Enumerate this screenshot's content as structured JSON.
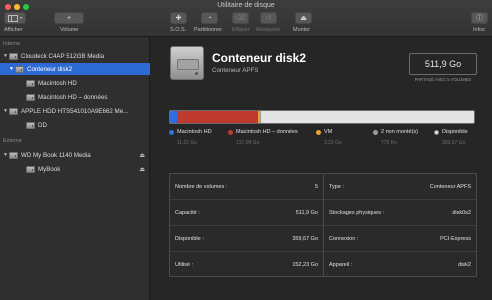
{
  "window": {
    "title": "Utilitaire de disque"
  },
  "toolbar": {
    "items": [
      {
        "label": "Afficher",
        "icon": "sidebar-toggle-icon",
        "enabled": true
      },
      {
        "label": "Volume",
        "icon": "plus-icon",
        "glyph": "+",
        "enabled": true
      },
      {
        "label": "S.O.S.",
        "icon": "stethoscope-icon",
        "glyph": "✚",
        "enabled": true
      },
      {
        "label": "Partitionner",
        "icon": "partition-icon",
        "glyph": "◔",
        "enabled": true
      },
      {
        "label": "Effacer",
        "icon": "erase-icon",
        "glyph": "⌫",
        "enabled": false
      },
      {
        "label": "Restaurer",
        "icon": "restore-icon",
        "glyph": "↺",
        "enabled": false
      },
      {
        "label": "Monter",
        "icon": "mount-icon",
        "glyph": "⏏",
        "enabled": true
      },
      {
        "label": "Infos",
        "icon": "info-icon",
        "glyph": "ⓘ",
        "enabled": true
      }
    ]
  },
  "sidebar": {
    "sections": [
      {
        "heading": "Interne"
      },
      {
        "heading": "Externe"
      }
    ],
    "items": [
      {
        "label": "Cloudeck C4AP 512GB Media",
        "level": 0,
        "disclosure": "▼",
        "selected": false,
        "eject": false
      },
      {
        "label": "Conteneur disk2",
        "level": 1,
        "disclosure": "▼",
        "selected": true,
        "eject": false
      },
      {
        "label": "Macintosh HD",
        "level": 2,
        "disclosure": "",
        "selected": false,
        "eject": false
      },
      {
        "label": "Macintosh HD – données",
        "level": 2,
        "disclosure": "",
        "selected": false,
        "eject": false
      },
      {
        "label": "APPLE HDD HTS541010A9E662 Me...",
        "level": 0,
        "disclosure": "▼",
        "selected": false,
        "eject": false
      },
      {
        "label": "DD",
        "level": 2,
        "disclosure": "",
        "selected": false,
        "eject": false
      },
      {
        "label": "WD My Book 1140 Media",
        "level": 0,
        "disclosure": "▼",
        "selected": false,
        "eject": true
      },
      {
        "label": "MyBook",
        "level": 2,
        "disclosure": "",
        "selected": false,
        "eject": true
      }
    ]
  },
  "header": {
    "title": "Conteneur disk2",
    "subtitle": "Conteneur APFS",
    "size": "511,9 Go",
    "size_caption": "PARTAGÉ AVEC 5 VOLUMES"
  },
  "usage": {
    "total_gb": 511.9,
    "segments": [
      {
        "name": "Macintosh HD",
        "value_gb": 11.21,
        "color": "#2f6fe0"
      },
      {
        "name": "Macintosh HD – données",
        "value_gb": 137.09,
        "color": "#c0392f"
      },
      {
        "name": "VM",
        "value_gb": 3.22,
        "color": "#e8a33a"
      },
      {
        "name": "2 non monté(s)",
        "value_gb": 0.000775,
        "color": "#9a9a9a"
      }
    ],
    "free_color": "#e4e4e4",
    "legend": [
      {
        "name": "Macintosh HD",
        "value": "11,21 Go",
        "color": "#2f6fe0"
      },
      {
        "name": "Macintosh HD – données",
        "value": "137,09 Go",
        "color": "#c0392f"
      },
      {
        "name": "VM",
        "value": "3,22 Go",
        "color": "#e8a33a"
      },
      {
        "name": "2 non monté(s)",
        "value": "775 Ko",
        "color": "#9a9a9a"
      },
      {
        "name": "Disponible",
        "value": "359,67 Go",
        "color": "#e4e4e4"
      }
    ]
  },
  "info": {
    "left": [
      {
        "label": "Nombre de volumes :",
        "value": "5"
      },
      {
        "label": "Capacité :",
        "value": "511,9 Go"
      },
      {
        "label": "Disponible :",
        "value": "359,67 Go"
      },
      {
        "label": "Utilisé :",
        "value": "152,23 Go"
      }
    ],
    "right": [
      {
        "label": "Type :",
        "value": "Conteneur APFS"
      },
      {
        "label": "Stockages physiques :",
        "value": "disk0s2"
      },
      {
        "label": "Connexion :",
        "value": "PCI-Express"
      },
      {
        "label": "Appareil :",
        "value": "disk2"
      }
    ]
  }
}
